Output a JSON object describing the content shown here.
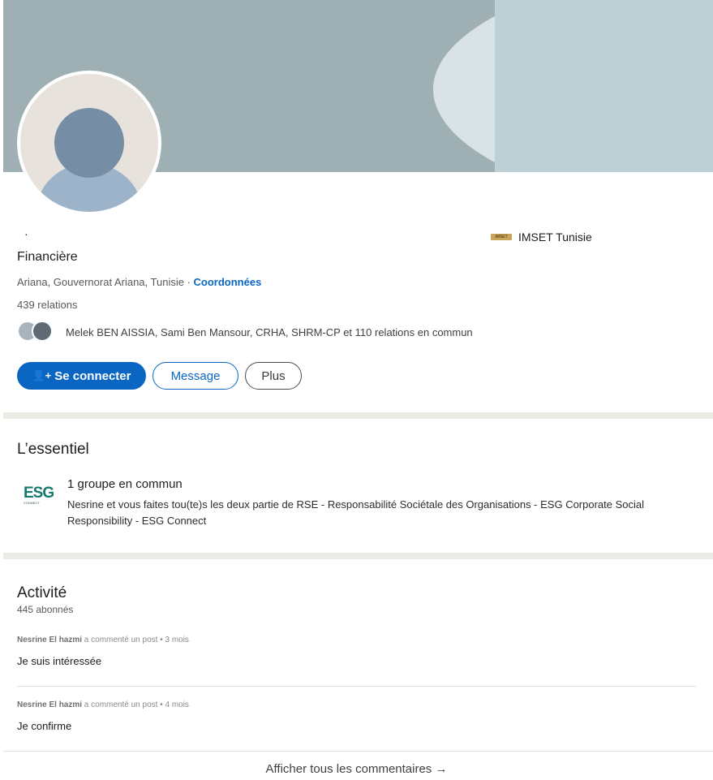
{
  "profile": {
    "name_placeholder": "·",
    "headline": "Financière",
    "location": "Ariana, Gouvernorat Ariana, Tunisie",
    "location_separator": " · ",
    "contact_link": "Coordonnées",
    "relations": "439 relations",
    "mutual_connections": "Melek BEN AISSIA, Sami Ben Mansour, CRHA, SHRM-CP et 110 relations en commun",
    "company": {
      "logo_text": "IMSET",
      "name": "IMSET Tunisie"
    }
  },
  "actions": {
    "connect_icon": "person-add-icon",
    "connect_label": "Se connecter",
    "message_label": "Message",
    "more_label": "Plus"
  },
  "essentiel": {
    "title": "L’essentiel",
    "logo_text": "ESG",
    "logo_subtext": "CONNECT",
    "group_title": "1 groupe en commun",
    "group_description": "Nesrine et vous faites tou(te)s les deux partie de RSE - Responsabilité Sociétale des Organisations - ESG Corporate Social Responsibility - ESG Connect"
  },
  "activity": {
    "title": "Activité",
    "followers": "445 abonnés",
    "posts": [
      {
        "author": "Nesrine El hazmi",
        "meta": " a commenté un post • 3 mois",
        "comment": "Je suis intéressée"
      },
      {
        "author": "Nesrine El hazmi",
        "meta": " a commenté un post • 4 mois",
        "comment": "Je confirme"
      }
    ],
    "show_all": "Afficher tous les commentaires →"
  },
  "colors": {
    "accent": "#0a66c2",
    "cover_main": "#9fb0b5",
    "cover_band": "#d9e2e4",
    "cover_right": "#bdd0d5",
    "esg_green": "#147a6d"
  }
}
